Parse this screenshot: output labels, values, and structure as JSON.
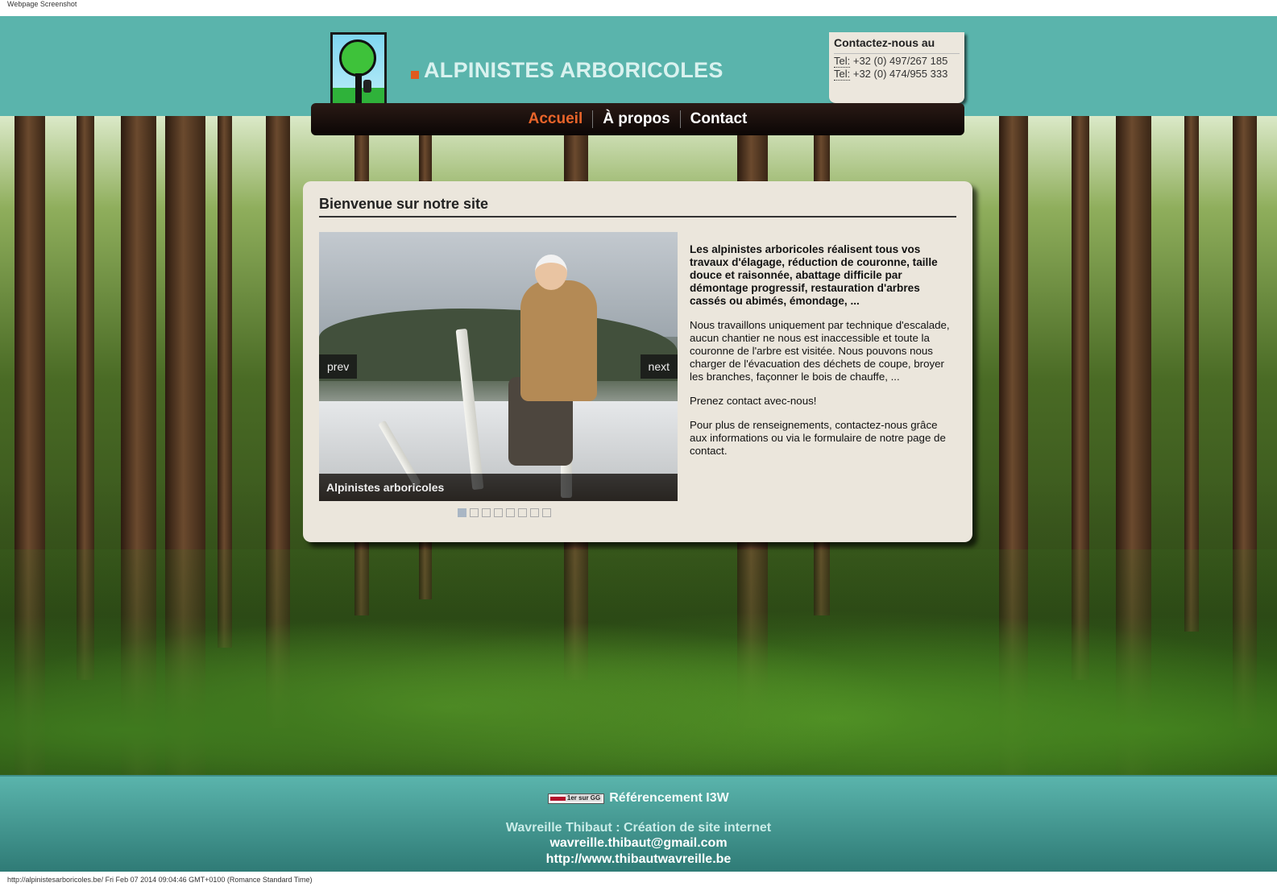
{
  "screenshot_caption": "Webpage Screenshot",
  "status_bar": "http://alpinistesarboricoles.be/ Fri Feb 07 2014 09:04:46 GMT+0100 (Romance Standard Time)",
  "header": {
    "logo_icon": "tree-climber-logo-icon",
    "site_title": "ALPINISTES ARBORICOLES",
    "contact": {
      "title": "Contactez-nous au",
      "phone_label": "Tel:",
      "phone1": "+32 (0) 497/267 185",
      "phone2": "+32 (0) 474/955 333"
    }
  },
  "nav": {
    "items": [
      {
        "label": "Accueil",
        "active": true
      },
      {
        "label": "À propos",
        "active": false
      },
      {
        "label": "Contact",
        "active": false
      }
    ]
  },
  "main": {
    "title": "Bienvenue sur notre site",
    "slider": {
      "prev_label": "prev",
      "next_label": "next",
      "caption": "Alpinistes arboricoles",
      "slide_count": 8,
      "active_slide": 1
    },
    "lead": "Les alpinistes arboricoles réalisent tous vos travaux d'élagage, réduction de couronne, taille douce et raisonnée, abattage difficile par démontage progressif, restauration d'arbres cassés ou abimés, émondage, ...",
    "p1": "Nous travaillons uniquement par technique d'escalade, aucun chantier ne nous est inaccessible et toute la couronne de l'arbre est visitée. Nous pouvons nous charger de l'évacuation des déchets de coupe, broyer les branches, façonner le bois de chauffe, ...",
    "p2": "Prenez contact avec-nous!",
    "p3": "Pour plus de renseignements, contactez-nous grâce aux informations ou via le formulaire de notre page de contact."
  },
  "footer": {
    "badge_text": "1er sur GG",
    "referencing": "Référencement I3W",
    "credit": "Wavreille Thibaut : Création de site internet",
    "email": "wavreille.thibaut@gmail.com",
    "website": "http://www.thibautwavreille.be"
  },
  "colors": {
    "header_teal": "#5ab4ac",
    "nav_active": "#e8642a",
    "panel_bg": "#ebe6dc"
  }
}
